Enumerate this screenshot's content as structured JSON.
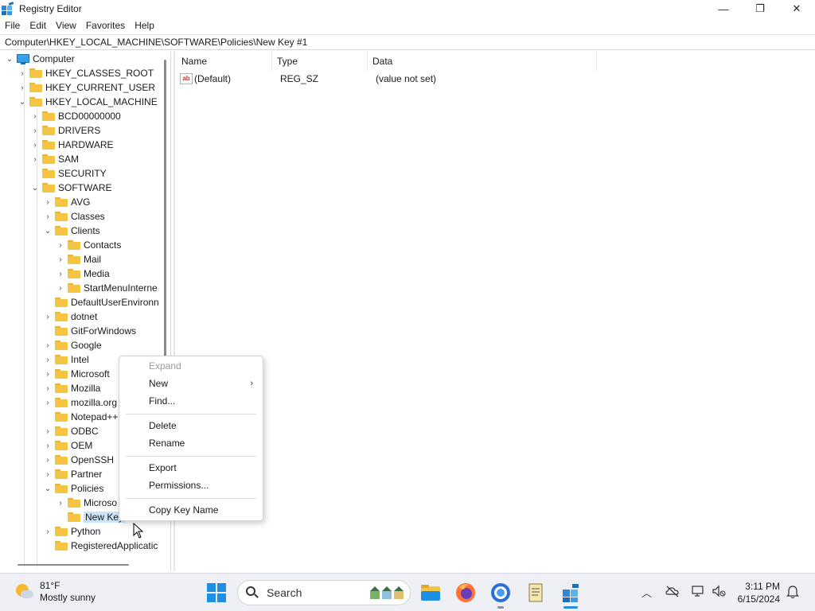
{
  "window": {
    "title": "Registry Editor",
    "minimize": "—",
    "maximize": "❐",
    "close": "✕"
  },
  "menu": [
    "File",
    "Edit",
    "View",
    "Favorites",
    "Help"
  ],
  "address": "Computer\\HKEY_LOCAL_MACHINE\\SOFTWARE\\Policies\\New Key #1",
  "tree": {
    "root": "Computer",
    "hkcr": "HKEY_CLASSES_ROOT",
    "hkcu": "HKEY_CURRENT_USER",
    "hklm": "HKEY_LOCAL_MACHINE",
    "bcd": "BCD00000000",
    "drivers": "DRIVERS",
    "hardware": "HARDWARE",
    "sam": "SAM",
    "security": "SECURITY",
    "software": "SOFTWARE",
    "avg": "AVG",
    "classes": "Classes",
    "clients": "Clients",
    "contacts": "Contacts",
    "mail": "Mail",
    "media": "Media",
    "startmenu": "StartMenuInterne",
    "defaultuser": "DefaultUserEnvironn",
    "dotnet": "dotnet",
    "gitforwindows": "GitForWindows",
    "google": "Google",
    "intel": "Intel",
    "microsoft": "Microsoft",
    "mozilla": "Mozilla",
    "mozillaorg": "mozilla.org",
    "notepadpp": "Notepad++",
    "odbc": "ODBC",
    "oem": "OEM",
    "openssh": "OpenSSH",
    "partner": "Partner",
    "policies": "Policies",
    "policies_microsoft": "Microso",
    "newkey": "New Key",
    "python": "Python",
    "registeredapps": "RegisteredApplicatic"
  },
  "list": {
    "headers": {
      "name": "Name",
      "type": "Type",
      "data": "Data"
    },
    "rows": [
      {
        "icon": "ab",
        "name": "(Default)",
        "type": "REG_SZ",
        "data": "(value not set)"
      }
    ]
  },
  "context_menu": {
    "expand": "Expand",
    "new": "New",
    "find": "Find...",
    "delete": "Delete",
    "rename": "Rename",
    "export": "Export",
    "permissions": "Permissions...",
    "copy_key_name": "Copy Key Name",
    "submenu_arrow": "›"
  },
  "taskbar": {
    "weather_temp": "81°F",
    "weather_desc": "Mostly sunny",
    "search_label": "Search",
    "time": "3:11 PM",
    "date": "6/15/2024"
  },
  "colors": {
    "selection": "#cce4f7",
    "folder": "#f5c542",
    "accent": "#1f8fe6"
  }
}
